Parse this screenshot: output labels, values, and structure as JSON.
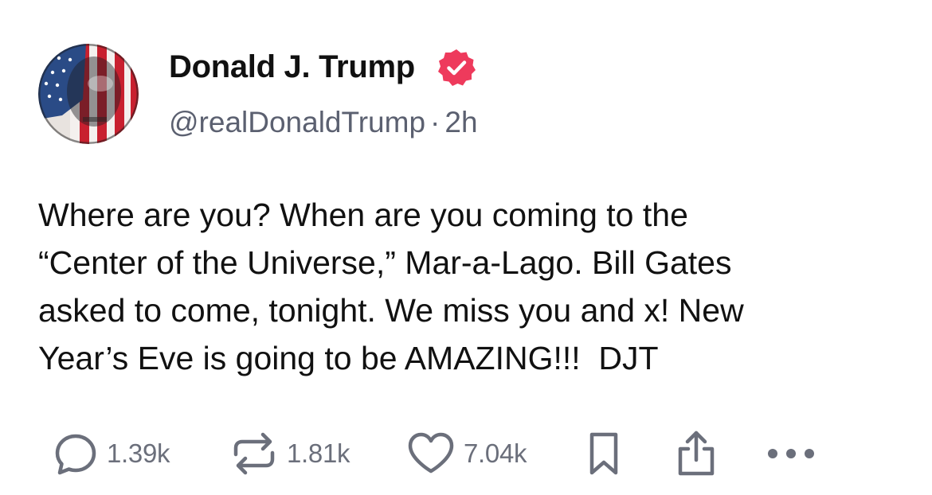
{
  "author": {
    "display_name": "Donald J. Trump",
    "handle": "@realDonaldTrump",
    "separator": "·",
    "timestamp": "2h",
    "verified": true,
    "avatar_icon": "flag-portrait-avatar",
    "verified_icon": "verified-badge-icon"
  },
  "post": {
    "text": "Where are you? When are you coming to the\n“Center of the Universe,” Mar-a-Lago. Bill Gates\nasked to come, tonight. We miss you and x! New\nYear’s Eve is going to be AMAZING!!!  DJT"
  },
  "actions": {
    "replies": "1.39k",
    "reposts": "1.81k",
    "likes": "7.04k"
  },
  "colors": {
    "text": "#111111",
    "muted": "#5b6070",
    "icon": "#6b6f7b",
    "verified": "#ee3a5c"
  }
}
